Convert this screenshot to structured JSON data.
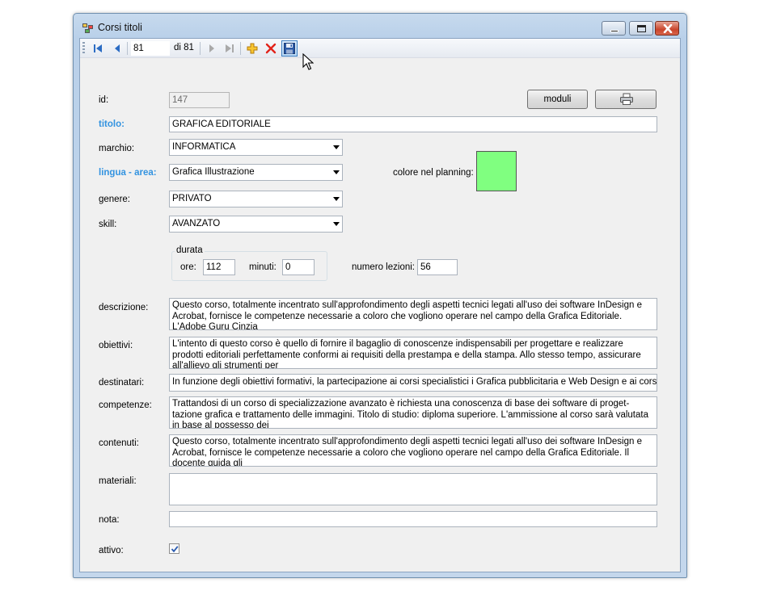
{
  "window": {
    "title": "Corsi titoli"
  },
  "navigator": {
    "position": "81",
    "count_label": "di 81"
  },
  "form": {
    "id": {
      "label": "id:",
      "value": "147"
    },
    "titolo": {
      "label": "titolo:",
      "value": "GRAFICA EDITORIALE"
    },
    "marchio": {
      "label": "marchio:",
      "value": "INFORMATICA"
    },
    "lingua_area": {
      "label": "lingua - area:",
      "value": "Grafica Illustrazione"
    },
    "colore": {
      "label": "colore nel planning:",
      "color": "#80ff80"
    },
    "genere": {
      "label": "genere:",
      "value": "PRIVATO"
    },
    "skill": {
      "label": "skill:",
      "value": "AVANZATO"
    },
    "durata": {
      "title": "durata",
      "ore_label": "ore:",
      "ore_value": "112",
      "minuti_label": "minuti:",
      "minuti_value": "0"
    },
    "numero_lezioni": {
      "label": "numero lezioni:",
      "value": "56"
    },
    "descrizione": {
      "label": "descrizione:",
      "value": "Questo corso, totalmente incentrato sull'approfondimento degli aspetti tecnici legati all'uso dei software InDesign e Acrobat, fornisce le competenze necessarie a coloro che vogliono operare nel campo della Grafica Editoriale. L'Adobe Guru Cinzia"
    },
    "obiettivi": {
      "label": "obiettivi:",
      "value": "L'intento di questo corso è quello di fornire il bagaglio di conoscenze indispensabili per progettare e realizzare prodotti editoriali perfettamente conformi ai requisiti della prestampa e della stampa. Allo stesso tempo, assicurare all'allievo gli strumenti per"
    },
    "destinatari": {
      "label": "destinatari:",
      "value": "In funzione degli obiettivi formativi, la partecipazione ai corsi specialistici i Grafica pubblicitaria e Web Design e ai corsi coordinat"
    },
    "competenze": {
      "label": "competenze:",
      "value": "Trattandosi di un corso di specializzazione avanzato è richiesta una conoscenza di base dei software di proget-tazione grafica e trattamento delle immagini. Titolo di studio: diploma superiore. L'ammissione al corso sarà valutata in base al possesso dei"
    },
    "contenuti": {
      "label": "contenuti:",
      "value": "Questo corso, totalmente incentrato sull'approfondimento degli aspetti tecnici legati all'uso dei software InDesign e Acrobat, fornisce le competenze necessarie a coloro che vogliono operare nel campo della Grafica Editoriale. Il docente guida gli"
    },
    "materiali": {
      "label": "materiali:",
      "value": ""
    },
    "nota": {
      "label": "nota:",
      "value": ""
    },
    "attivo": {
      "label": "attivo:",
      "checked": true
    }
  },
  "buttons": {
    "moduli": "moduli"
  },
  "icons": {
    "first": "first-record-icon",
    "prev": "previous-record-icon",
    "next": "next-record-icon",
    "last": "last-record-icon",
    "add": "add-record-icon",
    "delete": "delete-record-icon",
    "save": "save-icon",
    "print": "printer-icon"
  }
}
